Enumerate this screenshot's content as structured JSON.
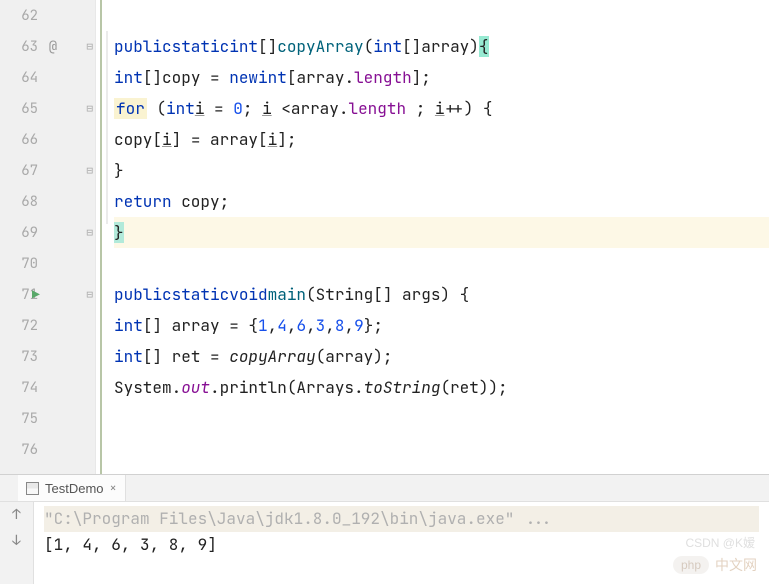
{
  "gutter": {
    "lines": [
      "62",
      "63",
      "64",
      "65",
      "66",
      "67",
      "68",
      "69",
      "70",
      "71",
      "72",
      "73",
      "74",
      "75",
      "76"
    ],
    "annotation_at": "@",
    "run_icon": "▶",
    "fold_open": "⊟",
    "fold_close": "⊟"
  },
  "code": {
    "l63": {
      "public": "public",
      "static": "static",
      "int": "int",
      "brackets": "[]",
      "name": "copyArray",
      "p_int": "int",
      "p_br": "[]",
      "p_name": "array",
      "brace": "{"
    },
    "l64": {
      "int": "int",
      "br": "[]",
      "var": "copy",
      "eq": " = ",
      "new": "new",
      "int2": "int",
      "open": "[array.",
      "len": "length",
      "close": "];"
    },
    "l65": {
      "for": "for",
      "open": " (",
      "int": "int",
      "i1": "i",
      "sep1": " = ",
      "zero": "0",
      "sep2": "; ",
      "i2": "i",
      "cmp": " <array.",
      "len": "length",
      "sep3": " ; ",
      "i3": "i",
      "inc": "++) {"
    },
    "l66": {
      "text1": "copy[",
      "i1": "i",
      "text2": "] = array[",
      "i2": "i",
      "text3": "];"
    },
    "l67": {
      "brace": "}"
    },
    "l68": {
      "return": "return",
      "text": " copy;"
    },
    "l69": {
      "brace": "}"
    },
    "l71": {
      "public": "public",
      "static": "static",
      "void": "void",
      "main": "main",
      "p_open": "(String[] args) {"
    },
    "l72": {
      "int": "int",
      "br": "[] array = {",
      "n1": "1",
      "c1": ",",
      "n2": "4",
      "c2": ",",
      "n3": "6",
      "c3": ",",
      "n4": "3",
      "c4": ",",
      "n5": "8",
      "c5": ",",
      "n6": "9",
      "close": "};"
    },
    "l73": {
      "int": "int",
      "br": "[] ret = ",
      "call": "copyArray",
      "args": "(array);"
    },
    "l74": {
      "sys": "System.",
      "out": "out",
      "dot": ".println(Arrays.",
      "ts": "toString",
      "end": "(ret));"
    }
  },
  "console": {
    "tab_label": "TestDemo",
    "cmd": "\"C:\\Program Files\\Java\\jdk1.8.0_192\\bin\\java.exe\" ...",
    "result": "[1, 4, 6, 3, 8, 9]"
  },
  "watermark": {
    "csdn": "CSDN @K嫒",
    "badge": "php",
    "site": "中文网"
  }
}
